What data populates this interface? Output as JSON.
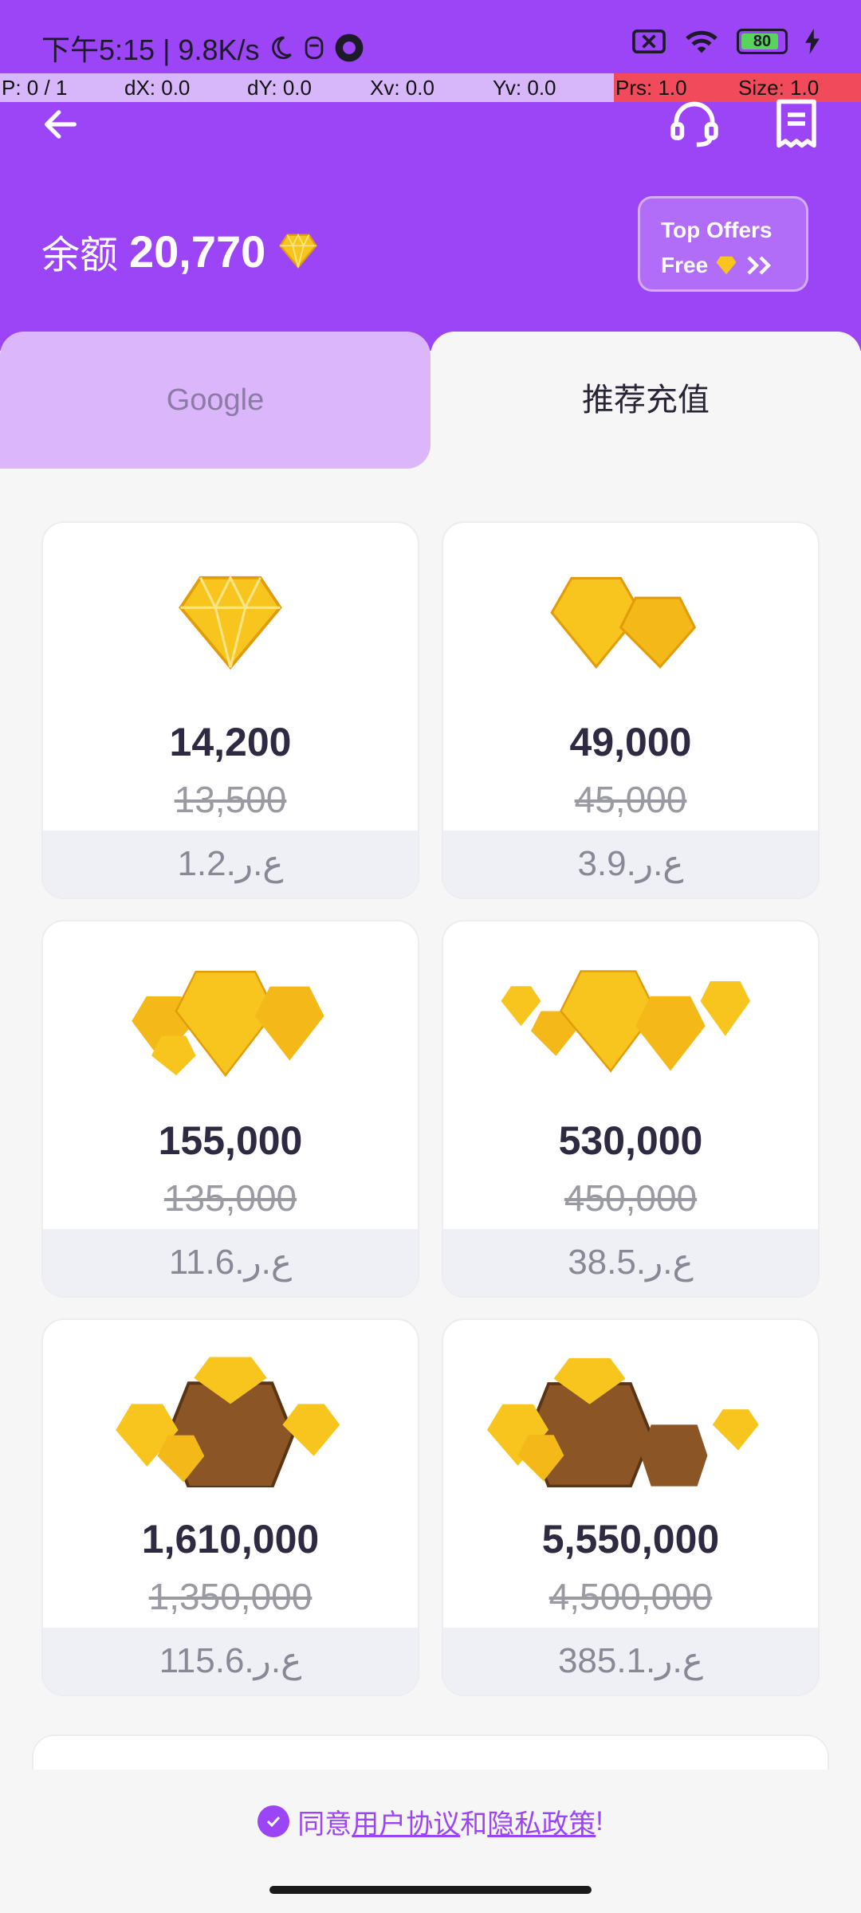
{
  "status_bar": {
    "time_speed": "下午5:15 | 9.8K/s",
    "battery": "80"
  },
  "debug_bar": {
    "p": "P: 0 / 1",
    "dx": "dX: 0.0",
    "dy": "dY: 0.0",
    "xv": "Xv: 0.0",
    "yv": "Yv: 0.0",
    "prs": "Prs: 1.0",
    "size": "Size: 1.0"
  },
  "balance": {
    "label": "余额",
    "amount": "20,770"
  },
  "top_offers": {
    "line1": "Top Offers",
    "line2": "Free"
  },
  "tabs": {
    "google": "Google",
    "recommended": "推荐充值"
  },
  "packages": [
    {
      "amount": "14,200",
      "original": "13,500",
      "price": "1.2.ع.ر"
    },
    {
      "amount": "49,000",
      "original": "45,000",
      "price": "3.9.ع.ر"
    },
    {
      "amount": "155,000",
      "original": "135,000",
      "price": "11.6.ع.ر"
    },
    {
      "amount": "530,000",
      "original": "450,000",
      "price": "38.5.ع.ر"
    },
    {
      "amount": "1,610,000",
      "original": "1,350,000",
      "price": "115.6.ع.ر"
    },
    {
      "amount": "5,550,000",
      "original": "4,500,000",
      "price": "385.1.ع.ر"
    }
  ],
  "agreement": {
    "prefix": "同意",
    "user_agreement": "用户协议",
    "and": "和",
    "privacy": "隐私政策",
    "suffix": "!"
  },
  "colors": {
    "accent": "#9b45f7",
    "gem": "#f7c51e"
  }
}
